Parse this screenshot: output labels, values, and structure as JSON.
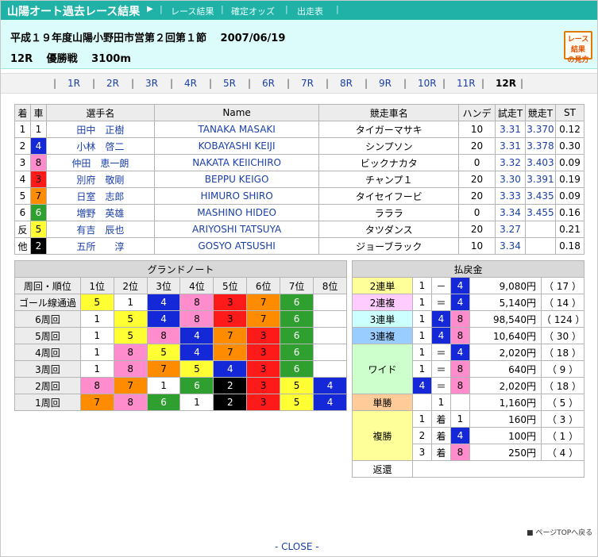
{
  "header": {
    "title": "山陽オート過去レース結果",
    "nav": [
      "レース結果",
      "確定オッズ",
      "出走表"
    ],
    "line1": "平成１９年度山陽小野田市営第２回第１節　 2007/06/19",
    "line2": "12R　 優勝戦　 3100m",
    "guide": "レース結果の見方"
  },
  "races": [
    "1R",
    "2R",
    "3R",
    "4R",
    "5R",
    "6R",
    "7R",
    "8R",
    "9R",
    "10R",
    "11R",
    "12R"
  ],
  "current_race": "12R",
  "results": {
    "columns": [
      "着",
      "車",
      "選手名",
      "Name",
      "競走車名",
      "ハンデ",
      "試走T",
      "競走T",
      "ST"
    ],
    "rows": [
      {
        "rank": "1",
        "car": "1",
        "jp": "田中　正樹",
        "en": "TANAKA MASAKI",
        "bike": "タイガーマサキ",
        "handi": "10",
        "trial": "3.31",
        "race": "3.370",
        "st": "0.12"
      },
      {
        "rank": "2",
        "car": "4",
        "jp": "小林　啓二",
        "en": "KOBAYASHI KEIJI",
        "bike": "シンプソン",
        "handi": "20",
        "trial": "3.31",
        "race": "3.378",
        "st": "0.30"
      },
      {
        "rank": "3",
        "car": "8",
        "jp": "仲田　恵一朗",
        "en": "NAKATA KEIICHIRO",
        "bike": "ビックナカタ",
        "handi": "0",
        "trial": "3.32",
        "race": "3.403",
        "st": "0.09"
      },
      {
        "rank": "4",
        "car": "3",
        "jp": "別府　敬剛",
        "en": "BEPPU KEIGO",
        "bike": "チャンプ１",
        "handi": "20",
        "trial": "3.30",
        "race": "3.391",
        "st": "0.19"
      },
      {
        "rank": "5",
        "car": "7",
        "jp": "日室　志郎",
        "en": "HIMURO SHIRO",
        "bike": "タイセイフービ",
        "handi": "20",
        "trial": "3.33",
        "race": "3.435",
        "st": "0.09"
      },
      {
        "rank": "6",
        "car": "6",
        "jp": "増野　英雄",
        "en": "MASHINO HIDEO",
        "bike": "ラララ",
        "handi": "0",
        "trial": "3.34",
        "race": "3.455",
        "st": "0.16"
      },
      {
        "rank": "反",
        "car": "5",
        "jp": "有吉　辰也",
        "en": "ARIYOSHI TATSUYA",
        "bike": "タツダンス",
        "handi": "20",
        "trial": "3.27",
        "race": "",
        "st": "0.21"
      },
      {
        "rank": "他",
        "car": "2",
        "jp": "五所　　淳",
        "en": "GOSYO ATSUSHI",
        "bike": "ジョーブラック",
        "handi": "10",
        "trial": "3.34",
        "race": "",
        "st": "0.18"
      }
    ]
  },
  "car_colors": {
    "1": {
      "bg": "#ffffff",
      "fg": "#000000"
    },
    "2": {
      "bg": "#000000",
      "fg": "#ffffff"
    },
    "3": {
      "bg": "#ff1a1a",
      "fg": "#000000"
    },
    "4": {
      "bg": "#1428d8",
      "fg": "#ffffff"
    },
    "5": {
      "bg": "#ffff33",
      "fg": "#000000"
    },
    "6": {
      "bg": "#2f9f2f",
      "fg": "#ffffff"
    },
    "7": {
      "bg": "#ff8c00",
      "fg": "#000000"
    },
    "8": {
      "bg": "#ff8ccc",
      "fg": "#000000"
    }
  },
  "grandnote": {
    "title": "グランドノート",
    "header": [
      "周回・順位",
      "1位",
      "2位",
      "3位",
      "4位",
      "5位",
      "6位",
      "7位",
      "8位"
    ],
    "rows": [
      {
        "label": "ゴール線通過",
        "cars": [
          "5",
          "1",
          "4",
          "8",
          "3",
          "7",
          "6",
          ""
        ]
      },
      {
        "label": "6周回",
        "cars": [
          "1",
          "5",
          "4",
          "8",
          "3",
          "7",
          "6",
          ""
        ]
      },
      {
        "label": "5周回",
        "cars": [
          "1",
          "5",
          "8",
          "4",
          "7",
          "3",
          "6",
          ""
        ]
      },
      {
        "label": "4周回",
        "cars": [
          "1",
          "8",
          "5",
          "4",
          "7",
          "3",
          "6",
          ""
        ]
      },
      {
        "label": "3周回",
        "cars": [
          "1",
          "8",
          "7",
          "5",
          "4",
          "3",
          "6",
          ""
        ]
      },
      {
        "label": "2周回",
        "cars": [
          "8",
          "7",
          "1",
          "6",
          "2",
          "3",
          "5",
          "4"
        ]
      },
      {
        "label": "1周回",
        "cars": [
          "7",
          "8",
          "6",
          "1",
          "2",
          "3",
          "5",
          "4"
        ]
      }
    ]
  },
  "payout": {
    "title": "払戻金",
    "rows": [
      {
        "type": "2連単",
        "a": "1",
        "op": "－",
        "b": "4",
        "c": "",
        "yen": "9,080円",
        "pop": "（ 17 ）"
      },
      {
        "type": "2連複",
        "a": "1",
        "op": "＝",
        "b": "4",
        "c": "",
        "yen": "5,140円",
        "pop": "（ 14 ）"
      },
      {
        "type": "3連単",
        "a": "1",
        "op": "4",
        "b": "8",
        "c": "",
        "yen": "98,540円",
        "pop": "（ 124 ）"
      },
      {
        "type": "3連複",
        "a": "1",
        "op": "4",
        "b": "8",
        "c": "",
        "yen": "10,640円",
        "pop": "（ 30 ）"
      },
      {
        "type": "ワイド",
        "a": "1",
        "op": "＝",
        "b": "4",
        "c": "",
        "yen": "2,020円",
        "pop": "（ 18 ）"
      },
      {
        "type": "",
        "a": "1",
        "op": "＝",
        "b": "8",
        "c": "",
        "yen": "640円",
        "pop": "（ 9 ）"
      },
      {
        "type": "",
        "a": "4",
        "op": "＝",
        "b": "8",
        "c": "",
        "yen": "2,020円",
        "pop": "（ 18 ）"
      },
      {
        "type": "単勝",
        "a": "",
        "op": "1",
        "b": "",
        "c": "",
        "yen": "1,160円",
        "pop": "（ 5 ）"
      },
      {
        "type": "複勝",
        "a": "1",
        "op": "着",
        "b": "1",
        "c": "",
        "yen": "160円",
        "pop": "（ 3 ）"
      },
      {
        "type": "",
        "a": "2",
        "op": "着",
        "b": "4",
        "c": "",
        "yen": "100円",
        "pop": "（ 1 ）"
      },
      {
        "type": "",
        "a": "3",
        "op": "着",
        "b": "8",
        "c": "",
        "yen": "250円",
        "pop": "（ 4 ）"
      },
      {
        "type": "返還",
        "a": "",
        "op": "",
        "b": "",
        "c": "",
        "yen": "",
        "pop": ""
      }
    ],
    "type_colors": {
      "2連単": "#ffff99",
      "2連複": "#ffccff",
      "3連単": "#ccffff",
      "3連複": "#99ccff",
      "ワイド": "#ccffcc",
      "単勝": "#ffcc99",
      "複勝": "#ffff99",
      "返還": "#ffffff"
    }
  },
  "footer": {
    "pagetop": "ページTOPへ戻る",
    "close": "- CLOSE -"
  }
}
